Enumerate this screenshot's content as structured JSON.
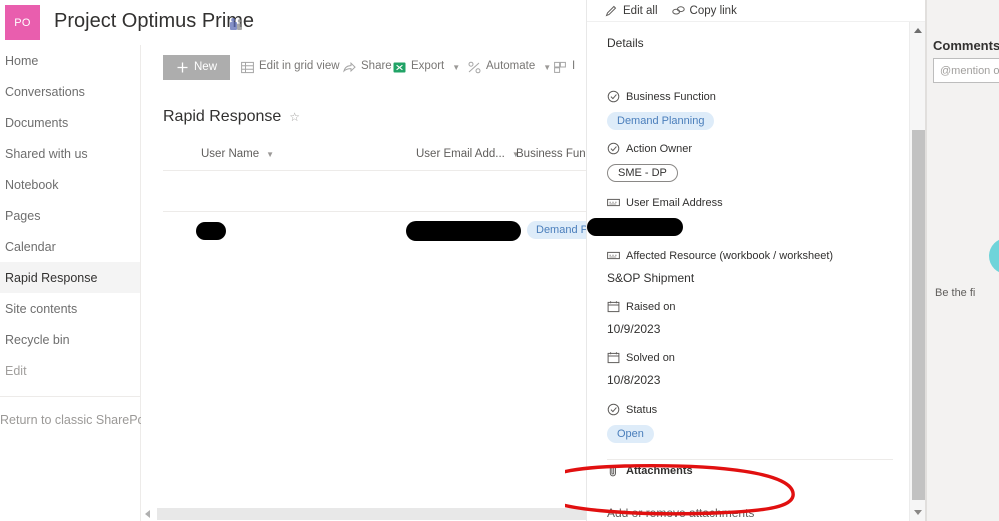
{
  "header": {
    "avatar_initials": "PO",
    "avatar_color": "#e95eae",
    "site_title": "Project Optimus Prime",
    "teams_icon": "teams-group-icon"
  },
  "sidebar": {
    "items": [
      {
        "label": "Home",
        "selected": false
      },
      {
        "label": "Conversations",
        "selected": false
      },
      {
        "label": "Documents",
        "selected": false
      },
      {
        "label": "Shared with us",
        "selected": false
      },
      {
        "label": "Notebook",
        "selected": false
      },
      {
        "label": "Pages",
        "selected": false
      },
      {
        "label": "Calendar",
        "selected": false
      },
      {
        "label": "Rapid Response",
        "selected": true
      },
      {
        "label": "Site contents",
        "selected": false
      },
      {
        "label": "Recycle bin",
        "selected": false
      },
      {
        "label": "Edit",
        "selected": false
      }
    ],
    "footer_link": "Return to classic SharePoint"
  },
  "command_bar": {
    "new_label": "New",
    "items": [
      {
        "label": "Edit in grid view",
        "icon": "grid-icon",
        "has_chevron": false
      },
      {
        "label": "Share",
        "icon": "share-icon",
        "has_chevron": false
      },
      {
        "label": "Export",
        "icon": "excel-icon",
        "has_chevron": true
      },
      {
        "label": "Automate",
        "icon": "automate-icon",
        "has_chevron": true
      },
      {
        "label": "I",
        "icon": "integrate-icon",
        "has_chevron": false
      }
    ]
  },
  "list": {
    "title": "Rapid Response",
    "favorite_icon": "star-icon",
    "columns": [
      {
        "label": "User Name",
        "has_chevron": true
      },
      {
        "label": "User Email Add...",
        "has_chevron": true
      },
      {
        "label": "Business Func",
        "has_chevron": false
      }
    ],
    "rows": [
      {
        "user_name": "",
        "user_email": "",
        "business_function": "Demand Plann"
      }
    ]
  },
  "details_panel": {
    "commands": [
      {
        "label": "Edit all",
        "icon": "pencil-icon"
      },
      {
        "label": "Copy link",
        "icon": "link-icon"
      }
    ],
    "section_title": "Details",
    "fields": [
      {
        "label": "Business Function",
        "icon": "choice-icon",
        "value": "Demand Planning",
        "style": "tag-blue"
      },
      {
        "label": "Action Owner",
        "icon": "choice-icon",
        "value": "SME - DP",
        "style": "tag-outline"
      },
      {
        "label": "User Email Address",
        "icon": "text-icon",
        "value": "",
        "style": "redacted"
      },
      {
        "label": "Affected Resource (workbook / worksheet)",
        "icon": "text-icon",
        "value": "S&OP Shipment",
        "style": "plain"
      },
      {
        "label": "Raised on",
        "icon": "calendar-icon",
        "value": "10/9/2023",
        "style": "plain"
      },
      {
        "label": "Solved on",
        "icon": "calendar-icon",
        "value": "10/8/2023",
        "style": "plain"
      },
      {
        "label": "Status",
        "icon": "choice-icon",
        "value": "Open",
        "style": "tag-blue"
      }
    ],
    "attachments": {
      "label": "Attachments",
      "icon": "paperclip-icon",
      "link": "Add or remove attachments"
    },
    "annotation_color": "#e11010"
  },
  "comments_panel": {
    "title": "Comments",
    "input_placeholder": "@mention or",
    "empty_text": "Be the fi",
    "illustration_color": "#6fd4da"
  }
}
